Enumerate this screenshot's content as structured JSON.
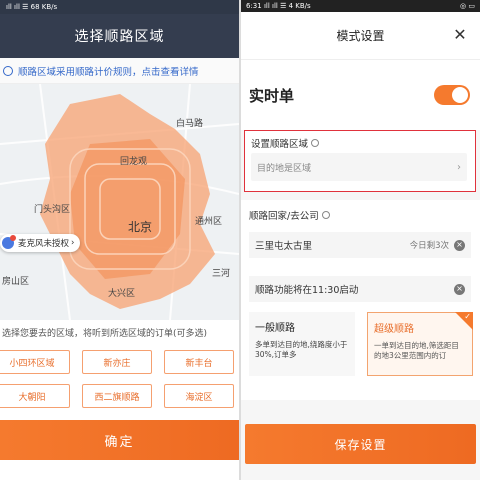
{
  "left": {
    "status": {
      "left": "ıll ıll ☰ 68 KB/s",
      "right": "◎ ◎ ▭"
    },
    "title": "选择顺路区域",
    "notice": "顺路区域采用顺路计价规则，点击查看详情",
    "map_labels": {
      "baiyanglu": "白马路",
      "huilongguan": "回龙观",
      "mentougou": "门头沟区",
      "beijing": "北京",
      "tongzhou": "通州区",
      "fangshan": "房山区",
      "daxing": "大兴区",
      "sanhe": "三河"
    },
    "mic_label": "麦克风未授权",
    "choose_tip": "选择您要去的区域，将听到所选区域的订单(可多选)",
    "chips": [
      "小四环区域",
      "新亦庄",
      "新丰台",
      "大朝阳",
      "西二旗顺路",
      "海淀区"
    ],
    "confirm": "确定",
    "colors": {
      "accent": "#f57a2e",
      "header": "#343d4f",
      "link": "#3468c9"
    }
  },
  "right": {
    "status": {
      "left": "6:31 ıll ıll ☰ 4 KB/s",
      "right": "◎ ▭"
    },
    "title": "模式设置",
    "close_glyph": "✕",
    "realtime_label": "实时单",
    "toggle_on": true,
    "area_title": "设置顺路区域",
    "dest_placeholder": "目的地是区域",
    "arrow_glyph": "›",
    "home_title": "顺路回家/去公司",
    "home_address": "三里屯太古里",
    "home_count": "今日剩3次",
    "home_start": "顺路功能将在11:30启动",
    "modes": [
      {
        "title": "一般顺路",
        "desc": "多单到达目的地,绕路度小于30%,订单多"
      },
      {
        "title": "超级顺路",
        "desc": "一单到达目的地,筛选距目的地3公里范围内的订"
      }
    ],
    "save": "保存设置",
    "colors": {
      "accent": "#f57a2e",
      "highlight_border": "#e0323c"
    }
  }
}
